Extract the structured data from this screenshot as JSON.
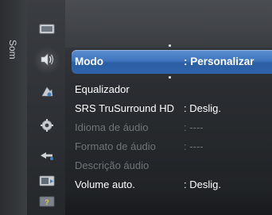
{
  "category": {
    "label": "Som"
  },
  "icons": [
    {
      "name": "picture-icon"
    },
    {
      "name": "sound-icon",
      "selected": true
    },
    {
      "name": "channel-icon"
    },
    {
      "name": "setup-icon"
    },
    {
      "name": "input-icon"
    },
    {
      "name": "application-icon"
    },
    {
      "name": "support-icon"
    }
  ],
  "menu": {
    "items": [
      {
        "label": "Modo",
        "value": ": Personalizar",
        "selected": true,
        "enabled": true
      },
      {
        "label": "Equalizador",
        "value": "",
        "selected": false,
        "enabled": true
      },
      {
        "label": "SRS TruSurround HD",
        "value": ": Deslig.",
        "selected": false,
        "enabled": true
      },
      {
        "label": "Idioma de áudio",
        "value": ": ----",
        "selected": false,
        "enabled": false
      },
      {
        "label": "Formato de áudio",
        "value": ": ----",
        "selected": false,
        "enabled": false
      },
      {
        "label": "Descrição áudio",
        "value": "",
        "selected": false,
        "enabled": false
      },
      {
        "label": "Volume auto.",
        "value": ": Deslig.",
        "selected": false,
        "enabled": true
      }
    ]
  },
  "colors": {
    "highlight": "#3f75bd",
    "text_enabled": "#ffffff",
    "text_disabled": "#707479"
  }
}
